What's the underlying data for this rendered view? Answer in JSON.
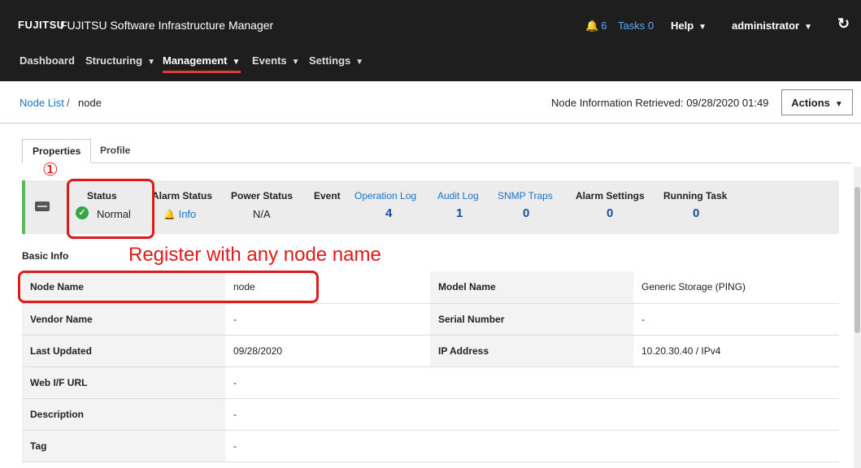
{
  "header": {
    "logo": "FUJITSU",
    "app_title": "FUJITSU Software Infrastructure Manager",
    "alarm_count": "6",
    "tasks_label": "Tasks 0",
    "help_label": "Help",
    "user_label": "administrator",
    "refresh_icon": "↻"
  },
  "nav": {
    "items": [
      "Dashboard",
      "Structuring",
      "Management",
      "Events",
      "Settings"
    ],
    "active": "Management"
  },
  "breadcrumb": {
    "link": "Node List",
    "separator": "/",
    "current": "node"
  },
  "retrieved": "Node Information Retrieved: 09/28/2020 01:49",
  "actions_label": "Actions",
  "tabs": [
    "Properties",
    "Profile"
  ],
  "status_panel": {
    "status_label": "Status",
    "status_value": "Normal",
    "alarm_label": "Alarm Status",
    "alarm_value": "Info",
    "power_label": "Power Status",
    "power_value": "N/A",
    "event_label": "Event",
    "oplog_label": "Operation Log",
    "oplog_value": "4",
    "audit_label": "Audit Log",
    "audit_value": "1",
    "snmp_label": "SNMP Traps",
    "snmp_value": "0",
    "alarm_settings_label": "Alarm Settings",
    "alarm_settings_value": "0",
    "running_label": "Running Task",
    "running_value": "0"
  },
  "annotation": {
    "marker": "①",
    "text": "Register with any node name"
  },
  "basic_info": {
    "title": "Basic Info",
    "rows": [
      {
        "k": "Node Name",
        "v": "node",
        "k2": "Model Name",
        "v2": "Generic Storage (PING)"
      },
      {
        "k": "Vendor Name",
        "v": "-",
        "k2": "Serial Number",
        "v2": "-"
      },
      {
        "k": "Last Updated",
        "v": "09/28/2020",
        "k2": "IP Address",
        "v2": "10.20.30.40 / IPv4"
      },
      {
        "k": "Web I/F URL",
        "v": "-",
        "k2": "",
        "v2": ""
      },
      {
        "k": "Description",
        "v": "-",
        "k2": "",
        "v2": ""
      },
      {
        "k": "Tag",
        "v": "-",
        "k2": "",
        "v2": ""
      }
    ]
  },
  "colors": {
    "accent_red": "#e01a1a",
    "link_blue": "#1a73c9",
    "status_green": "#35a447"
  }
}
